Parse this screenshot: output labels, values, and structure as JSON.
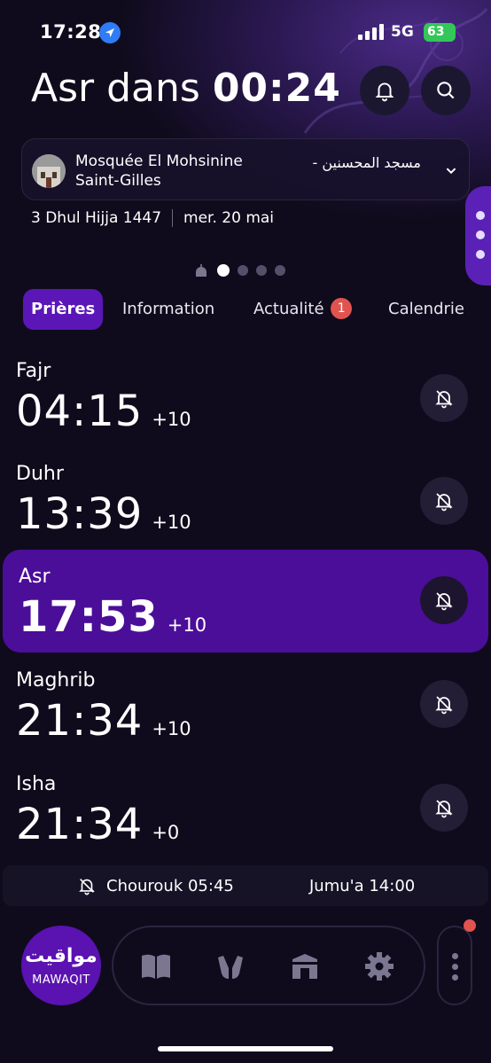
{
  "status_bar": {
    "time": "17:28",
    "network": "5G",
    "battery": "63"
  },
  "header": {
    "next_prayer_label": "Asr dans",
    "countdown": "00:24"
  },
  "mosque": {
    "name": "Mosquée El Mohsinine Saint-Gilles",
    "name_ar": "مسجد المحسنين -"
  },
  "date": {
    "hijri": "3 Dhul Hijja 1447",
    "gregorian": "mer. 20 mai"
  },
  "tabs": [
    {
      "label": "Prières",
      "active": true
    },
    {
      "label": "Information"
    },
    {
      "label": "Actualité",
      "badge": "1"
    },
    {
      "label": "Calendrie"
    }
  ],
  "prayers": [
    {
      "name": "Fajr",
      "time": "04:15",
      "offset": "+10",
      "active": false
    },
    {
      "name": "Duhr",
      "time": "13:39",
      "offset": "+10",
      "active": false
    },
    {
      "name": "Asr",
      "time": "17:53",
      "offset": "+10",
      "active": true
    },
    {
      "name": "Maghrib",
      "time": "21:34",
      "offset": "+10",
      "active": false
    },
    {
      "name": "Isha",
      "time": "21:34",
      "offset": "+0",
      "active": false
    }
  ],
  "extra": {
    "chourouk": "Chourouk 05:45",
    "jumua": "Jumu'a 14:00"
  },
  "bottom_nav": {
    "logo_ar": "مواقيت",
    "logo_en": "MAWAQIT",
    "icons": [
      "quran-icon",
      "dua-hands-icon",
      "kaaba-icon",
      "settings-gear-icon"
    ]
  },
  "colors": {
    "accent": "#5b16b8",
    "active_row": "#4b0e99",
    "background": "#0f0b1c",
    "badge": "#e0534f"
  }
}
